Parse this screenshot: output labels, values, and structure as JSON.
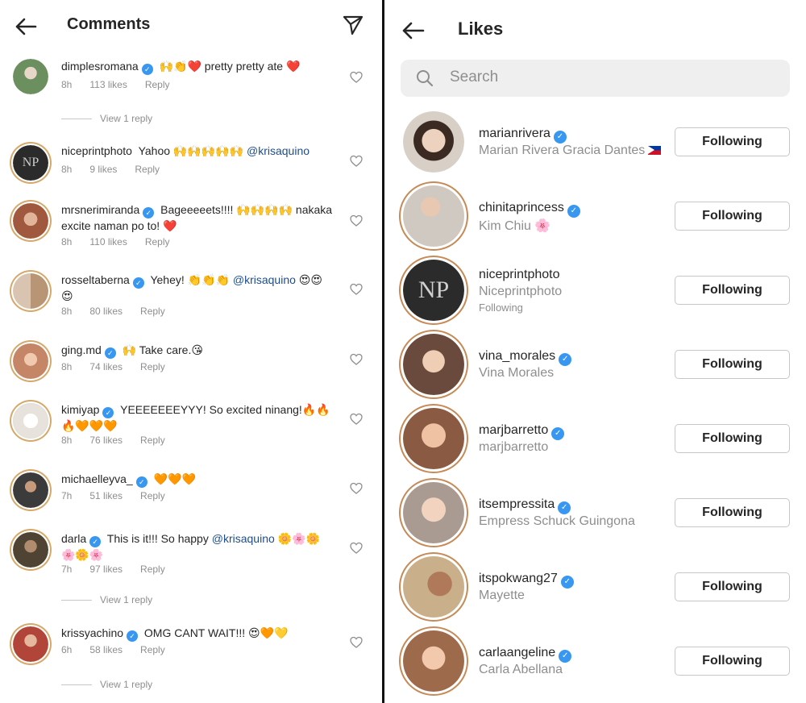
{
  "comments_panel": {
    "title": "Comments",
    "comments": [
      {
        "username": "dimplesromana",
        "verified": true,
        "text": "🙌👏❤️ pretty pretty ate ❤️",
        "time": "8h",
        "likes": "113 likes",
        "reply": "Reply",
        "avatar_color": "#6b8f5e"
      },
      {
        "username": "niceprintphoto",
        "verified": false,
        "text": "Yahoo 🙌🙌🙌🙌🙌",
        "mention": "@krisaquino",
        "time": "8h",
        "likes": "9 likes",
        "reply": "Reply",
        "avatar_color": "#2b2b2b"
      },
      {
        "username": "mrsnerimiranda",
        "verified": true,
        "text": "Bageeeeets!!!! 🙌🙌🙌🙌 nakaka excite naman po to! ❤️",
        "time": "8h",
        "likes": "110 likes",
        "reply": "Reply",
        "avatar_color": "#a0583f"
      },
      {
        "username": "rosseltaberna",
        "verified": true,
        "text": "Yehey! 👏👏👏",
        "mention": "@krisaquino",
        "text_after": "😍😍😍",
        "time": "8h",
        "likes": "80 likes",
        "reply": "Reply",
        "avatar_color": "#b89574"
      },
      {
        "username": "ging.md",
        "verified": true,
        "text": "🙌 Take care.😘",
        "time": "8h",
        "likes": "74 likes",
        "reply": "Reply",
        "avatar_color": "#c58567"
      },
      {
        "username": "kimiyap",
        "verified": true,
        "text": "YEEEEEEEYYY! So excited ninang!🔥🔥🔥🧡🧡🧡",
        "time": "8h",
        "likes": "76 likes",
        "reply": "Reply",
        "avatar_color": "#e8e2dc"
      },
      {
        "username": "michaelleyva_",
        "verified": true,
        "text": "🧡🧡🧡",
        "time": "7h",
        "likes": "51 likes",
        "reply": "Reply",
        "avatar_color": "#3b3b3b"
      },
      {
        "username": "darla",
        "verified": true,
        "text": "This is it!!! So happy",
        "mention": "@krisaquino",
        "text_after": "🌼🌸🌼🌸🌼🌸",
        "time": "7h",
        "likes": "97 likes",
        "reply": "Reply",
        "avatar_color": "#4f4434"
      },
      {
        "username": "krissyachino",
        "verified": true,
        "text": "OMG CANT WAIT!!! 😍🧡💛",
        "time": "6h",
        "likes": "58 likes",
        "reply": "Reply",
        "avatar_color": "#b2453a"
      }
    ],
    "view_reply_label": "View 1 reply"
  },
  "likes_panel": {
    "title": "Likes",
    "search_placeholder": "Search",
    "users": [
      {
        "username": "marianrivera",
        "verified": true,
        "name": "Marian Rivera Gracia Dantes",
        "flag": true,
        "button": "Following",
        "avatar_color": "#d8cfc7",
        "ring": false
      },
      {
        "username": "chinitaprincess",
        "verified": true,
        "name": "Kim Chiu 🌸",
        "button": "Following",
        "avatar_color": "#cfc9c2",
        "ring": true
      },
      {
        "username": "niceprintphoto",
        "verified": false,
        "name": "Niceprintphoto",
        "extra": "Following",
        "button": "Following",
        "avatar_color": "#2b2b2b",
        "ring": true
      },
      {
        "username": "vina_morales",
        "verified": true,
        "name": "Vina Morales",
        "button": "Following",
        "avatar_color": "#6a4a3c",
        "ring": true
      },
      {
        "username": "marjbarretto",
        "verified": true,
        "name": "marjbarretto",
        "button": "Following",
        "avatar_color": "#8a5a43",
        "ring": true
      },
      {
        "username": "itsempressita",
        "verified": true,
        "name": "Empress Schuck Guingona",
        "button": "Following",
        "avatar_color": "#a99a92",
        "ring": true
      },
      {
        "username": "itspokwang27",
        "verified": true,
        "name": "Mayette",
        "button": "Following",
        "avatar_color": "#c9b08a",
        "ring": true
      },
      {
        "username": "carlaangeline",
        "verified": true,
        "name": "Carla Abellana",
        "button": "Following",
        "avatar_color": "#9d6a4c",
        "ring": true
      }
    ]
  },
  "colors": {
    "verified": "#3897f0",
    "mention": "#1e4d8c",
    "secondary_text": "#8e8e8e",
    "ring": "#d6a96b"
  }
}
